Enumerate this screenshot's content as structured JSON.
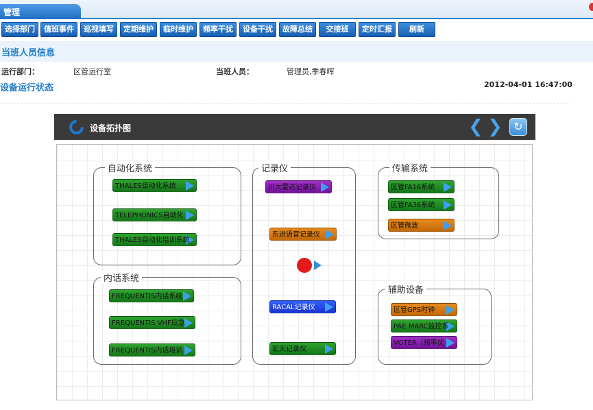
{
  "tabbar": {
    "active_tab": "管理"
  },
  "toolbar": {
    "buttons": [
      "选择部门",
      "值班事件",
      "巡视填写",
      "定期维护",
      "临时维护",
      "频率干扰",
      "设备干扰",
      "故障总结",
      "交接班",
      "定时汇报",
      "刷新"
    ]
  },
  "duty_info": {
    "title": "当班人员信息",
    "dept_label": "运行部门：",
    "dept_value": "区管运行室",
    "staff_label": "当班人员：",
    "staff_value": "管理员,季春晖"
  },
  "status": {
    "title": "设备运行状态",
    "datetime": "2012-04-01 16:47:00"
  },
  "panel": {
    "title": "设备拓扑图"
  },
  "groups": {
    "automation": {
      "label": "自动化系统",
      "devices": [
        "THALES自动化系统",
        "TELEPHONICS自动化",
        "THALES自动化培训系统"
      ]
    },
    "recorder": {
      "label": "记录仪",
      "devices": [
        "川大雷达记录仪",
        "东进语音记录仪",
        "RACAL记录仪",
        "宏天记录仪"
      ]
    },
    "transmission": {
      "label": "传输系统",
      "devices": [
        "区管FA16系统",
        "区管FA36系统",
        "区管微波"
      ]
    },
    "intercom": {
      "label": "内话系统",
      "devices": [
        "FREQUENTIS内话系统",
        "FREQUENTIS  VHF应急",
        "FREQUENTIS内话培训"
      ]
    },
    "aux": {
      "label": "辅助设备",
      "devices": [
        "区管GPS时钟",
        "PAE MARC监控系",
        "VOTER（频率优"
      ]
    }
  },
  "colors": {
    "green": "#1f8c22",
    "purple": "#8a20b0",
    "orange": "#d97a10",
    "blue": "#2545e8",
    "alarm_red": "#e41a1a",
    "accent_blue": "#1f7cc8"
  }
}
